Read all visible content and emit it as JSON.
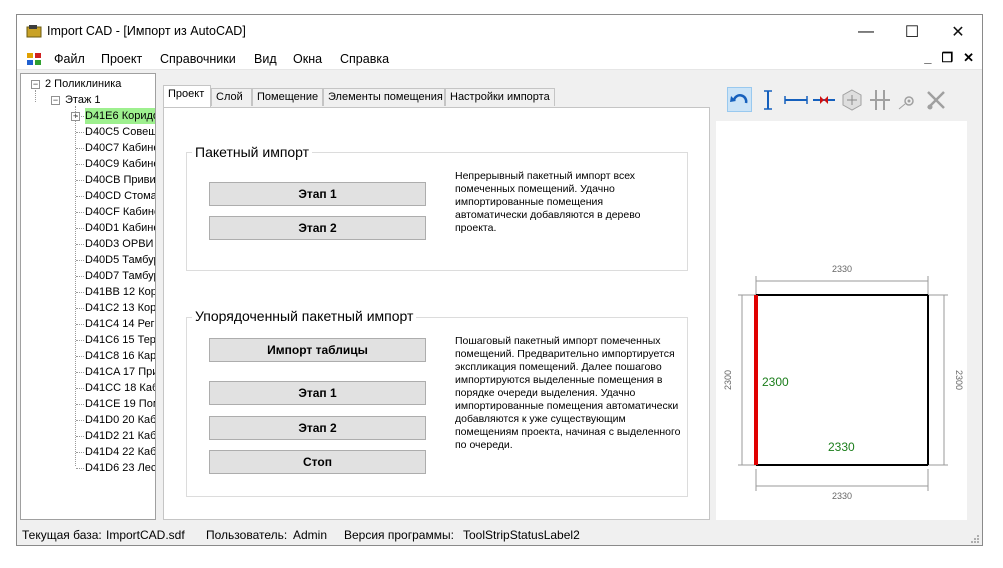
{
  "window": {
    "title": "Import CAD - [Импорт из AutoCAD]",
    "minimize_glyph": "—",
    "maximize_glyph": "☐",
    "close_glyph": "✕"
  },
  "menu": {
    "items": [
      "Файл",
      "Проект",
      "Справочники",
      "Вид",
      "Окна",
      "Справка"
    ],
    "mdi_minimize": "_",
    "mdi_restore": "❐",
    "mdi_close": "✕"
  },
  "tree": {
    "root": "2 Поликлиника",
    "floor": "Этаж 1",
    "expand_glyph": "−",
    "collapse_glyph": "+",
    "items": [
      "D41E6 Коридо",
      "D40C5 Совещ",
      "D40C7 Кабине",
      "D40C9 Кабине",
      "D40CB Привив",
      "D40CD Стомат",
      "D40CF Кабине",
      "D40D1 Кабине",
      "D40D3 ОРВИ в",
      "D40D5 Тамбур",
      "D40D7 Тамбур",
      "D41BB 12 Кор",
      "D41C2 13 Кор",
      "D41C4 14 Регі",
      "D41C6 15 Тера",
      "D41C8 16 Кар",
      "D41CA 17 При",
      "D41CC 18 Каб",
      "D41CE 19 Пом",
      "D41D0 20 Каб",
      "D41D2 21 Каб",
      "D41D4 22 Каб",
      "D41D6 23 Лес"
    ]
  },
  "tabs": [
    "Проект",
    "Слой",
    "Помещение",
    "Элементы помещения",
    "Настройки импорта"
  ],
  "batch": {
    "title": "Пакетный импорт",
    "stage1": "Этап 1",
    "stage2": "Этап 2",
    "description": "Непрерывный пакетный импорт всех помеченных помещений. Удачно импортированные помещения автоматически добавляются в дерево проекта."
  },
  "ordered": {
    "title": "Упорядоченный пакетный импорт",
    "import_table": "Импорт таблицы",
    "stage1": "Этап 1",
    "stage2": "Этап 2",
    "stop": "Стоп",
    "description": "Пошаговый пакетный импорт помеченных помещений. Предварительно импортируется экспликация помещений. Далее пошагово импортируются выделенные помещения в порядке очереди выделения. Удачно импортированные помещения автоматически добавляются к уже существующим помещениям проекта, начиная с выделенного по очереди."
  },
  "preview": {
    "dim_top": "2330",
    "dim_bottom": "2330",
    "dim_left": "2300",
    "dim_right": "2300",
    "label_wall_left": "2300",
    "label_wall_bottom": "2330",
    "colors": {
      "selected_wall": "#e00000",
      "wall": "#000000",
      "dimension": "#9a9a9a",
      "label": "#1a7d1a"
    }
  },
  "status": {
    "db_label": "Текущая база:",
    "db_value": "ImportCAD.sdf",
    "user_label": "Пользователь:",
    "user_value": "Admin",
    "version_label": "Версия программы:",
    "version_value": "ToolStripStatusLabel2"
  },
  "colors": {
    "tree_selected": "#9ef08f",
    "tool_active": "#cce4f7",
    "tool_blue": "#1560bd",
    "tool_red": "#d01010"
  }
}
